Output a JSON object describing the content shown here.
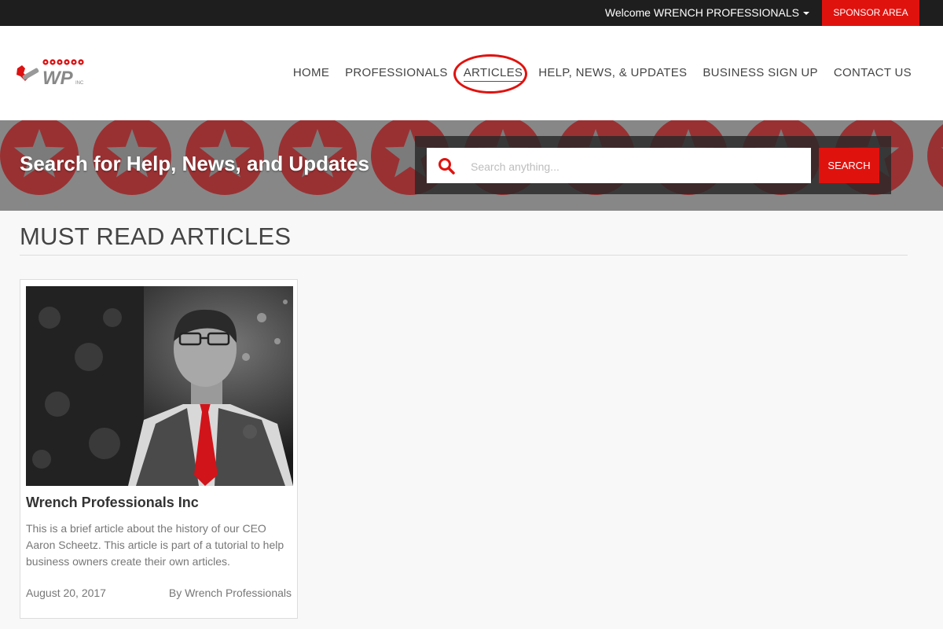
{
  "topbar": {
    "welcome_label": "Welcome WRENCH PROFESSIONALS",
    "sponsor_label": "SPONSOR AREA"
  },
  "logo": {
    "text": "WP",
    "sub": "INC"
  },
  "nav": {
    "items": [
      {
        "label": "HOME"
      },
      {
        "label": "PROFESSIONALS"
      },
      {
        "label": "ARTICLES",
        "active": true
      },
      {
        "label": "HELP, NEWS, & UPDATES"
      },
      {
        "label": "BUSINESS SIGN UP"
      },
      {
        "label": "CONTACT US"
      }
    ]
  },
  "hero": {
    "title": "Search for Help, News, and Updates",
    "search_placeholder": "Search anything...",
    "search_button": "SEARCH"
  },
  "section": {
    "title": "MUST READ ARTICLES"
  },
  "articles": [
    {
      "title": "Wrench Professionals Inc",
      "excerpt": "This is a brief article about the history of our CEO Aaron Scheetz. This article is part of a tutorial to help business owners create their own articles.",
      "date": "August 20, 2017",
      "author": "By Wrench Professionals"
    }
  ],
  "colors": {
    "accent": "#e0120e",
    "topbar": "#1e1e1e",
    "hero_bg": "#8c8c8c"
  },
  "icons": {
    "search": "search-icon",
    "caret": "caret-down-icon"
  }
}
